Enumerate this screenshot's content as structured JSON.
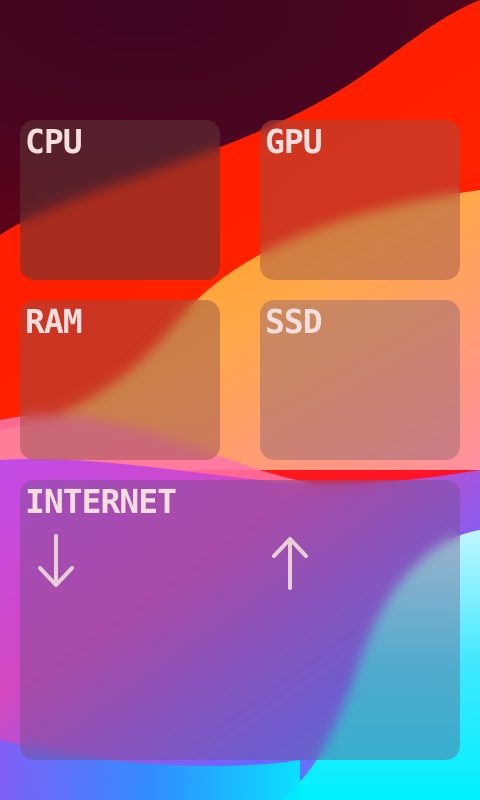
{
  "tiles": {
    "cpu": {
      "label": "CPU"
    },
    "gpu": {
      "label": "GPU"
    },
    "ram": {
      "label": "RAM"
    },
    "ssd": {
      "label": "SSD"
    },
    "internet": {
      "label": "INTERNET",
      "download_icon": "arrow-down-icon",
      "upload_icon": "arrow-up-icon"
    }
  },
  "colors": {
    "label_text": "#f7dede",
    "arrow": "#e8cfd8",
    "wallpaper_dark": "#4a0620",
    "wallpaper_red": "#ff1a00",
    "wallpaper_orange": "#ff8a00",
    "wallpaper_pink": "#ff7ab0",
    "wallpaper_purple": "#b04cf0",
    "wallpaper_blue": "#2f8cff",
    "wallpaper_cyan": "#00f4ff"
  }
}
